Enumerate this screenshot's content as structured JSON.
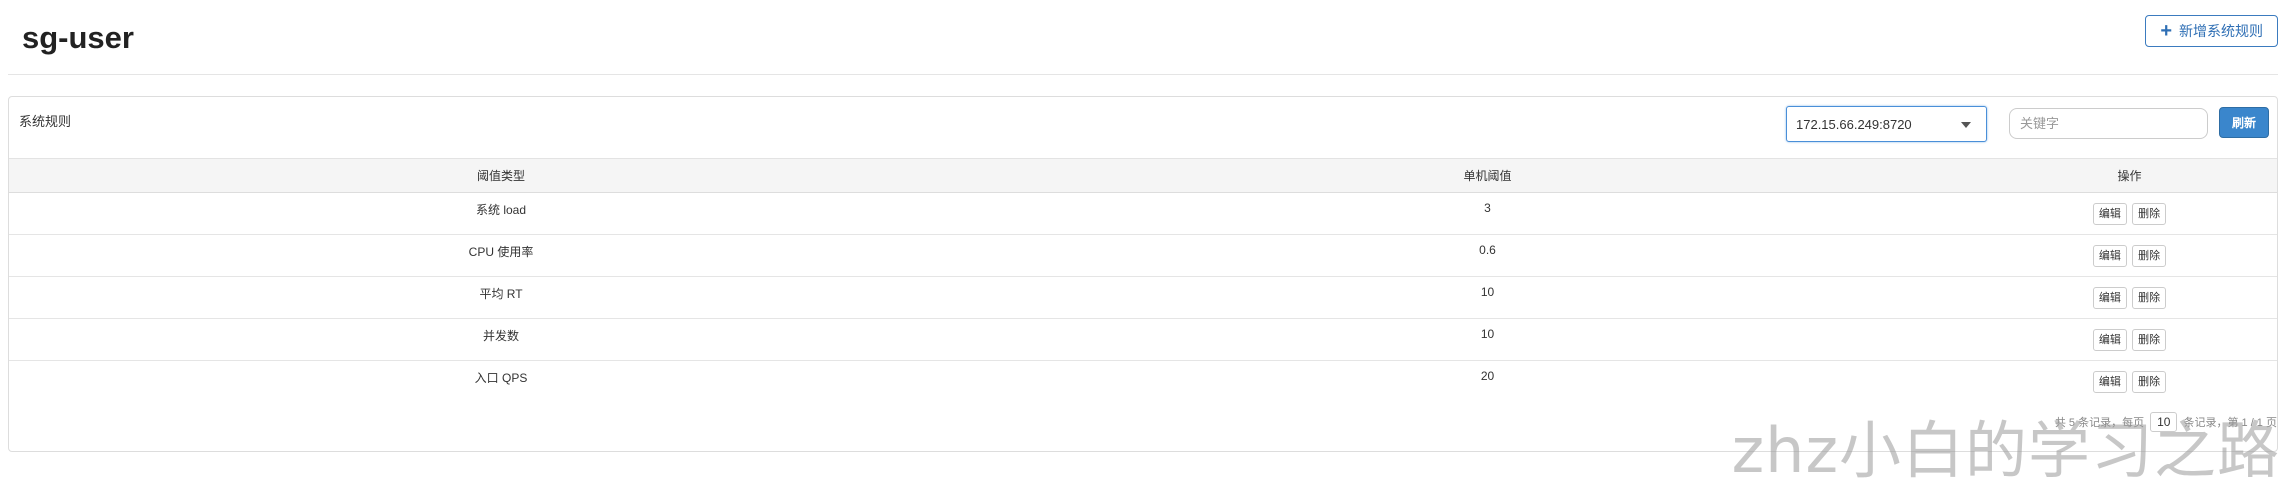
{
  "page": {
    "title": "sg-user",
    "add_button_label": "新增系统规则"
  },
  "panel": {
    "heading": "系统规则",
    "machine_selected": "172.15.66.249:8720",
    "search_placeholder": "关键字",
    "refresh_label": "刷新"
  },
  "table": {
    "headers": [
      "阈值类型",
      "单机阈值",
      "操作"
    ],
    "rows": [
      {
        "type": "系统 load",
        "threshold": "3"
      },
      {
        "type": "CPU 使用率",
        "threshold": "0.6"
      },
      {
        "type": "平均 RT",
        "threshold": "10"
      },
      {
        "type": "并发数",
        "threshold": "10"
      },
      {
        "type": "入口 QPS",
        "threshold": "20"
      }
    ],
    "edit_label": "编辑",
    "delete_label": "删除"
  },
  "pagination": {
    "summary_left": "共 5 条记录，每页",
    "page_size": "10",
    "summary_right": "条记录，第 1 / 1 页"
  },
  "watermark": "zhz小白的学习之路"
}
